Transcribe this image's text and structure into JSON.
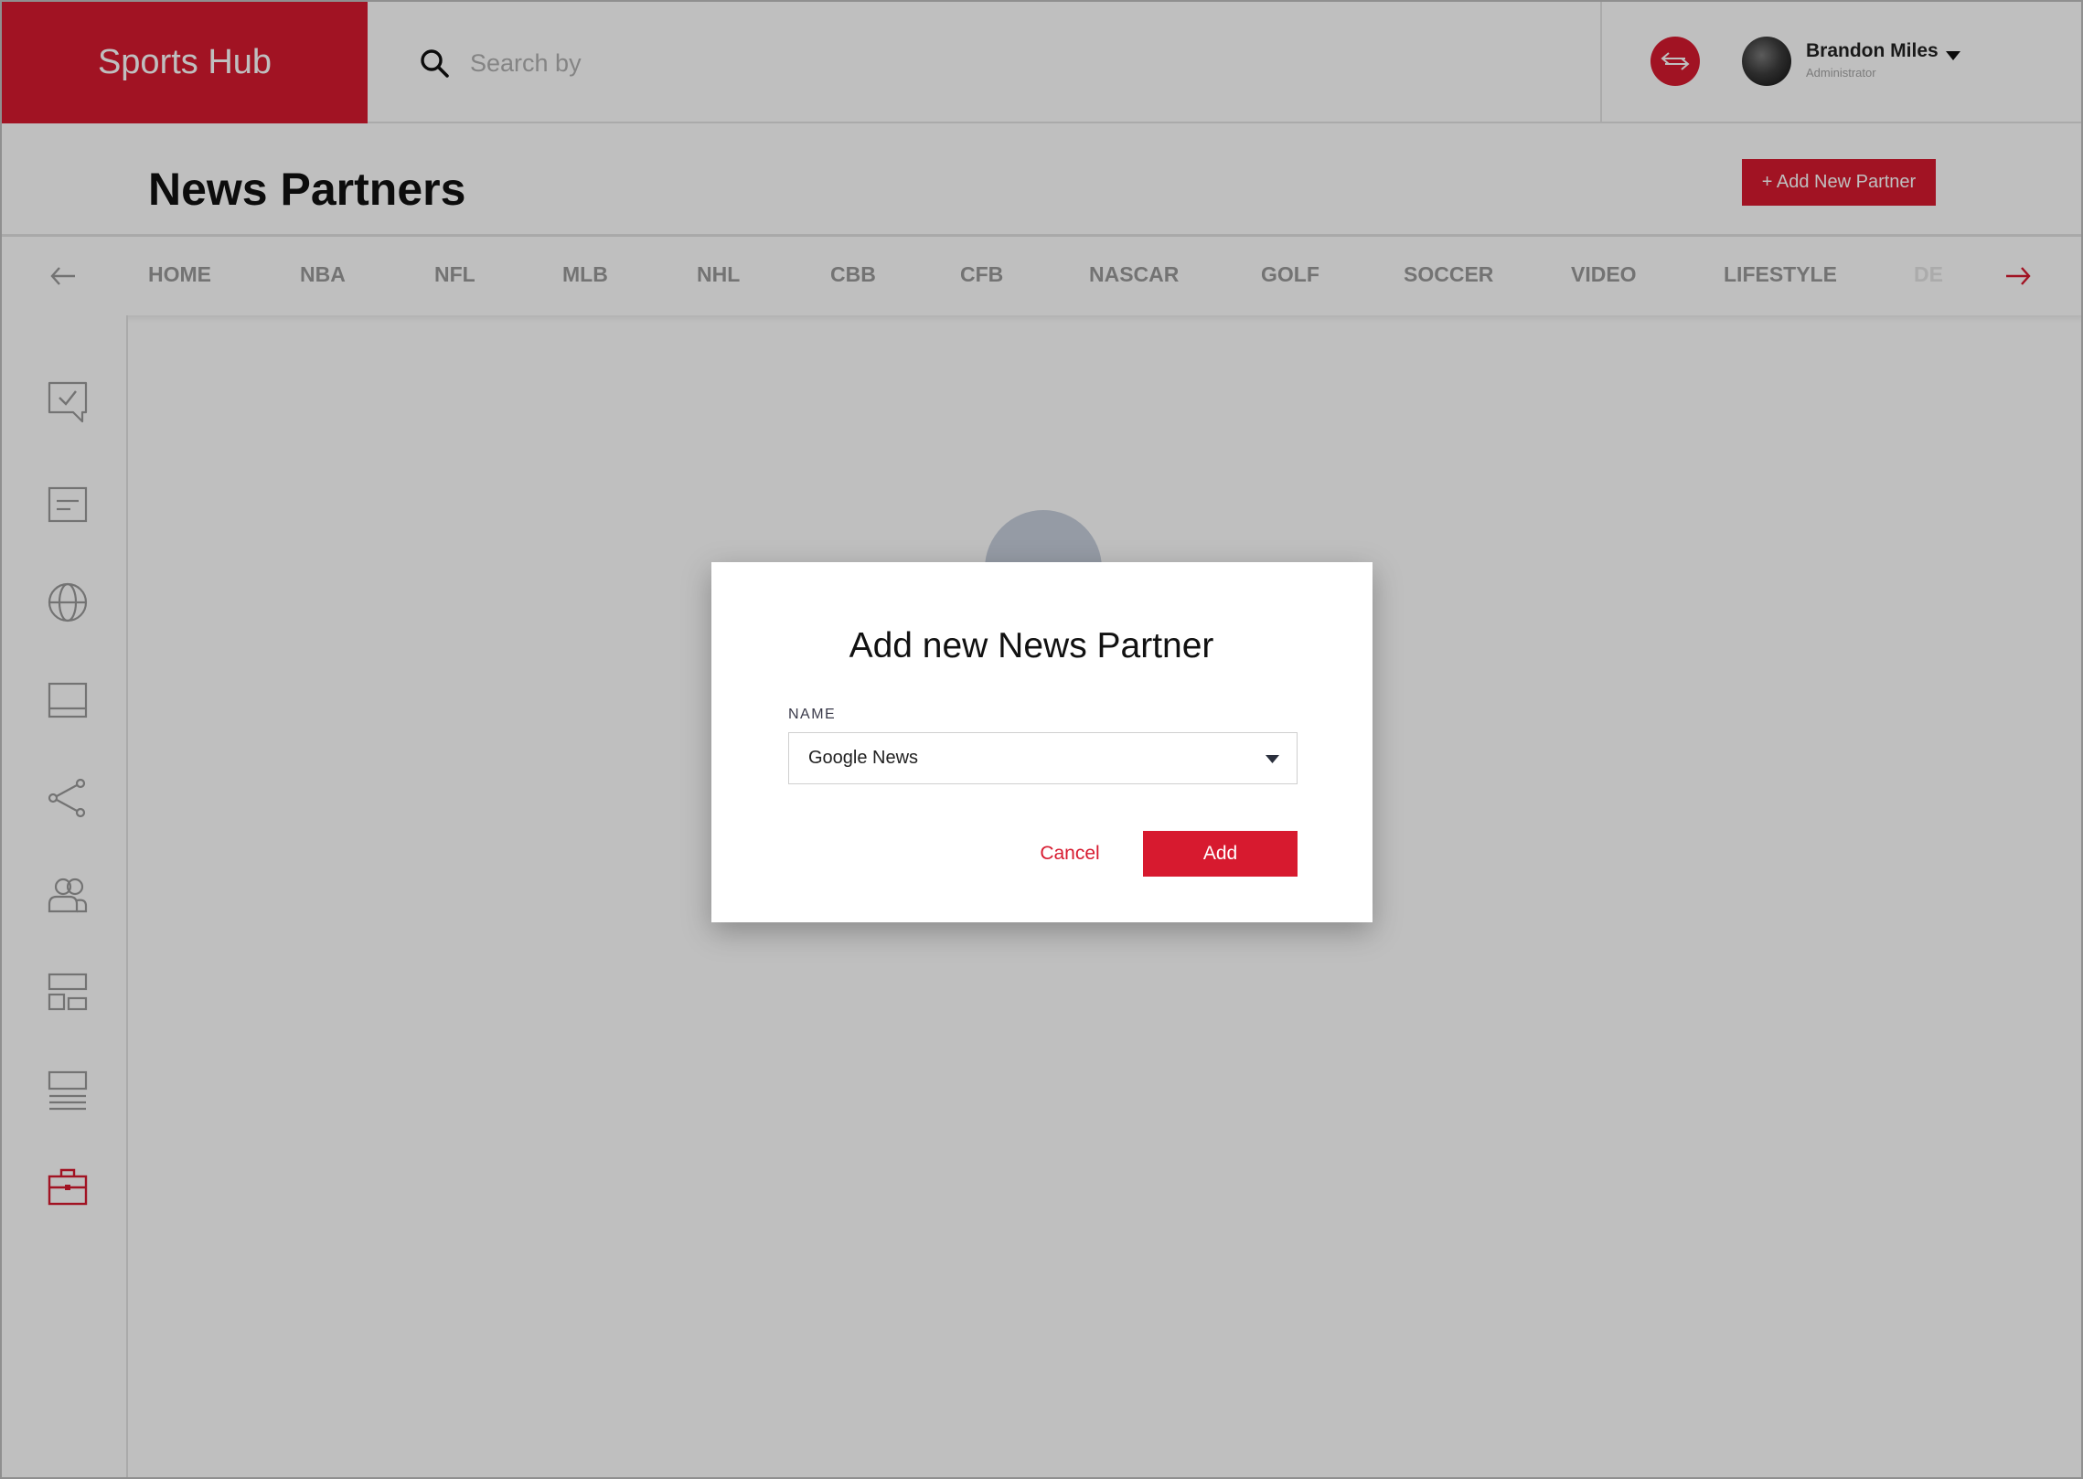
{
  "header": {
    "brand": "Sports Hub",
    "search_placeholder": "Search by",
    "user": {
      "name": "Brandon Miles",
      "role": "Administrator"
    }
  },
  "page": {
    "title": "News Partners",
    "add_button": "+ Add New Partner"
  },
  "categories": [
    "HOME",
    "NBA",
    "NFL",
    "MLB",
    "NHL",
    "CBB",
    "CFB",
    "NASCAR",
    "GOLF",
    "SOCCER",
    "VIDEO",
    "LIFESTYLE",
    "DE"
  ],
  "sidebar": {
    "items": [
      "chat-check-icon",
      "document-icon",
      "globe-icon",
      "panel-icon",
      "share-icon",
      "users-icon",
      "layout-icon",
      "list-icon",
      "briefcase-icon"
    ],
    "active": "briefcase-icon"
  },
  "modal": {
    "title": "Add new News Partner",
    "field_label": "NAME",
    "field_value": "Google News",
    "cancel": "Cancel",
    "submit": "Add"
  },
  "colors": {
    "accent": "#d71a2f",
    "muted_text": "#9a9a9a",
    "border": "#e3e3e3"
  }
}
